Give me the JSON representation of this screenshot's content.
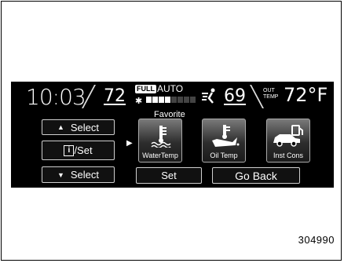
{
  "status": {
    "clock": "10:03",
    "driver_temp": "72",
    "fan_mode_full": "FULL",
    "fan_mode_auto": "AUTO",
    "fan_level": 0.5,
    "passenger_temp": "69",
    "outside_label_line1": "OUT",
    "outside_label_line2": "TEMP",
    "outside_temp": "72°F"
  },
  "menu": {
    "favorite_title": "Favorite",
    "select_up": "Select",
    "info_set": "/Set",
    "select_down": "Select",
    "set_button": "Set",
    "go_back_button": "Go Back"
  },
  "tiles": [
    {
      "label": "WaterTemp",
      "icon": "water-temp-icon"
    },
    {
      "label": "Oil Temp",
      "icon": "oil-temp-icon"
    },
    {
      "label": "Inst Cons",
      "icon": "fuel-consumption-icon"
    }
  ],
  "figure_number": "304990"
}
